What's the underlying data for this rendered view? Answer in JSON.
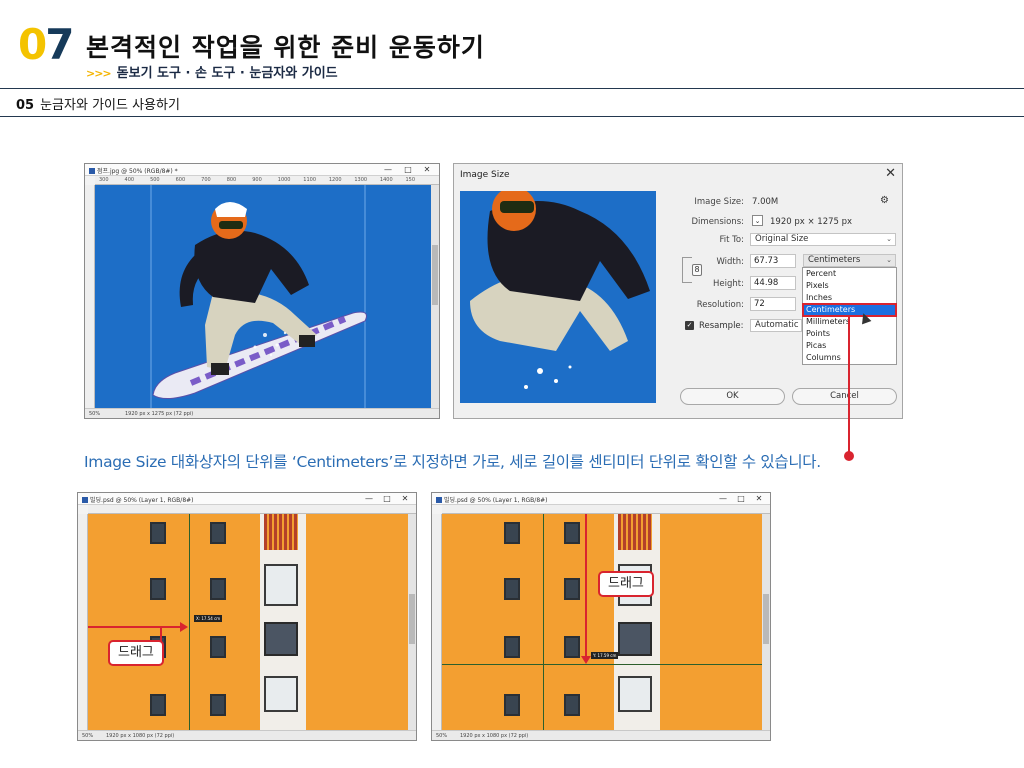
{
  "header": {
    "chapter_num_first": "0",
    "chapter_num_second": "7",
    "chapter_title": "본격적인 작업을 위한 준비 운동하기",
    "sub_arrows": ">>>",
    "sub_title": "돋보기 도구 · 손 도구 · 눈금자와 가이드",
    "section_num": "05",
    "section_title": "눈금자와 가이드 사용하기"
  },
  "colors": {
    "chapter_accent": "#f4c300",
    "chapter_dark": "#163a5a",
    "caption_blue": "#2b6db4",
    "highlight_red": "#d9242f",
    "selection_blue": "#1c6fe0",
    "sky_blue": "#1d6ec7",
    "building_orange": "#f39f31"
  },
  "snow_window": {
    "doc_title": "점프.jpg @ 50% (RGB/8#) *",
    "ruler_ticks": [
      "300",
      "400",
      "500",
      "600",
      "700",
      "800",
      "900",
      "1000",
      "1100",
      "1200",
      "1300",
      "1400",
      "150"
    ],
    "zoom": "50%",
    "dimensions": "1920 px x 1275 px (72 ppi)",
    "min_icon": "—",
    "max_icon": "□",
    "close_icon": "✕"
  },
  "image_size_dialog": {
    "title": "Image Size",
    "close_icon": "✕",
    "image_size_label": "Image Size:",
    "image_size_value": "7.00M",
    "gear_icon": "⚙",
    "dimensions_label": "Dimensions:",
    "dimensions_value": "1920 px  ×  1275 px",
    "fit_to_label": "Fit To:",
    "fit_to_value": "Original Size",
    "width_label": "Width:",
    "width_value": "67.73",
    "height_label": "Height:",
    "height_value": "44.98",
    "resolution_label": "Resolution:",
    "resolution_value": "72",
    "resample_label": "Resample:",
    "resample_value": "Automatic",
    "unit_selected": "Centimeters",
    "unit_options": [
      "Percent",
      "Pixels",
      "Inches",
      "Centimeters",
      "Millimeters",
      "Points",
      "Picas",
      "Columns"
    ],
    "ok_label": "OK",
    "cancel_label": "Cancel"
  },
  "caption": "Image Size 대화상자의 단위를 ‘Centimeters’로 지정하면 가로, 세로 길이를 센티미터 단위로 확인할 수 있습니다.",
  "building_left": {
    "doc_title": "빌딩.psd @ 50% (Layer 1, RGB/8#)",
    "zoom": "50%",
    "dimensions": "1920 px x 1080 px (72 ppi)",
    "callout": "드래그",
    "tooltip": "X: 17.54 cm"
  },
  "building_right": {
    "doc_title": "빌딩.psd @ 50% (Layer 1, RGB/8#)",
    "zoom": "50%",
    "dimensions": "1920 px x 1080 px (72 ppi)",
    "callout": "드래그",
    "tooltip": "Y: 17.59 cm"
  }
}
